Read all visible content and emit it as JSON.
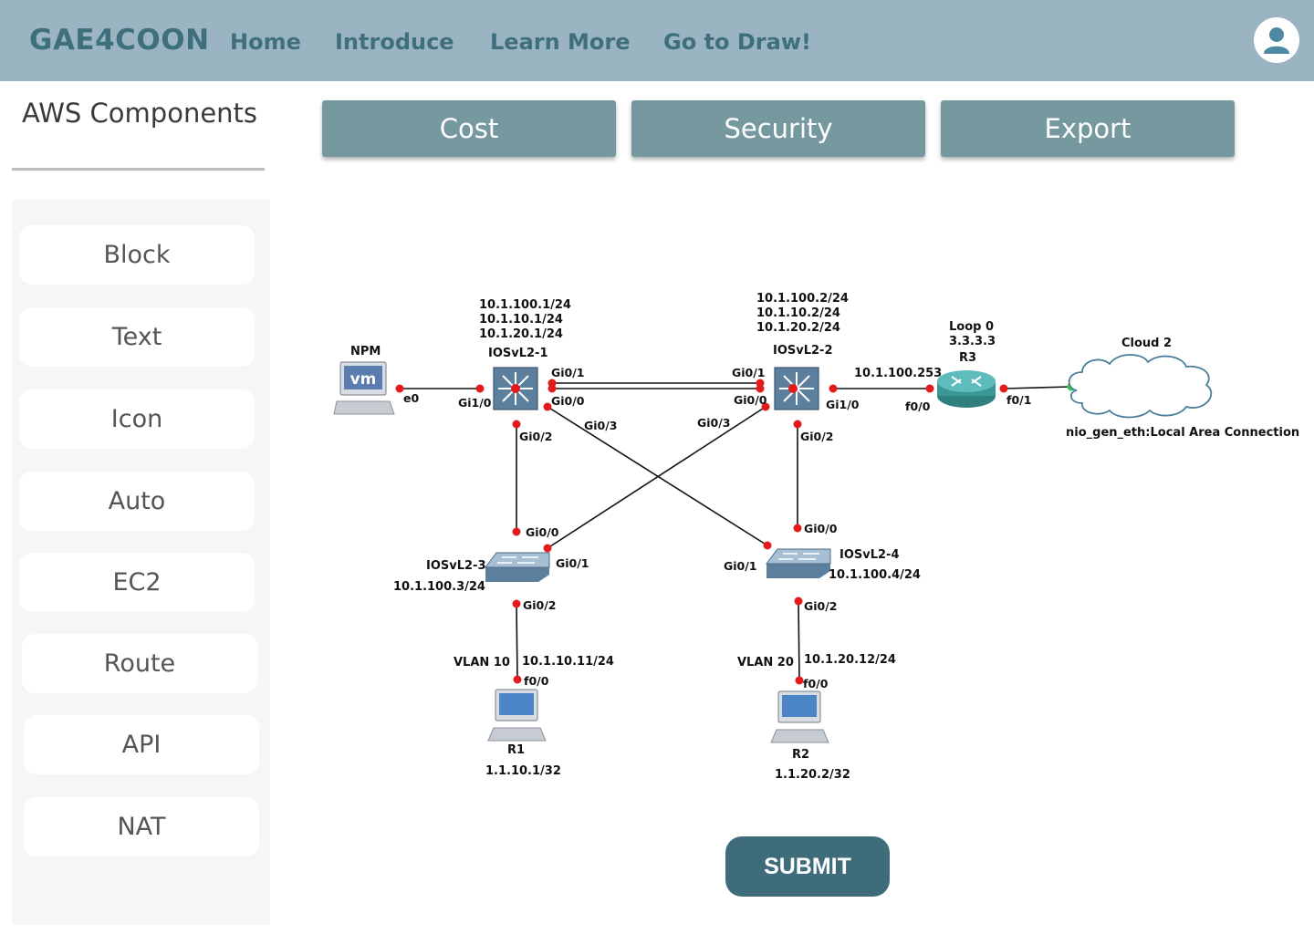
{
  "header": {
    "logo": "GAE4COON",
    "nav": [
      "Home",
      "Introduce",
      "Learn More",
      "Go to Draw!"
    ],
    "avatar_icon": "user-avatar-icon"
  },
  "sidebar": {
    "title": "AWS Components",
    "items": [
      "Block",
      "Text",
      "Icon",
      "Auto",
      "EC2",
      "Route",
      "API",
      "NAT"
    ]
  },
  "toolbar": {
    "cost": "Cost",
    "security": "Security",
    "export": "Export"
  },
  "diagram": {
    "npm": {
      "name": "NPM",
      "icon_text": "vm",
      "port": "e0"
    },
    "sw1": {
      "name": "IOSvL2-1",
      "ip1": "10.1.100.1/24",
      "ip2": "10.1.10.1/24",
      "ip3": "10.1.20.1/24",
      "p_gi10": "Gi1/0",
      "p_gi01": "Gi0/1",
      "p_gi00": "Gi0/0",
      "p_gi03": "Gi0/3",
      "p_gi02": "Gi0/2"
    },
    "sw2": {
      "name": "IOSvL2-2",
      "ip1": "10.1.100.2/24",
      "ip2": "10.1.10.2/24",
      "ip3": "10.1.20.2/24",
      "p_gi01": "Gi0/1",
      "p_gi00": "Gi0/0",
      "p_gi10": "Gi1/0",
      "p_gi03": "Gi0/3",
      "p_gi02": "Gi0/2",
      "link_ip": "10.1.100.253"
    },
    "r3": {
      "name": "R3",
      "loop": "Loop 0",
      "loop_ip": "3.3.3.3",
      "p_f00": "f0/0",
      "p_f01": "f0/1"
    },
    "cloud": {
      "name": "Cloud 2",
      "label": "nio_gen_eth:Local Area Connection"
    },
    "sw3": {
      "name": "IOSvL2-3",
      "ip": "10.1.100.3/24",
      "p_gi00": "Gi0/0",
      "p_gi01": "Gi0/1",
      "p_gi02": "Gi0/2"
    },
    "sw4": {
      "name": "IOSvL2-4",
      "ip": "10.1.100.4/24",
      "p_gi00": "Gi0/0",
      "p_gi01": "Gi0/1",
      "p_gi02": "Gi0/2"
    },
    "r1": {
      "name": "R1",
      "vlan": "VLAN 10",
      "ip": "10.1.10.11/24",
      "port": "f0/0",
      "loop_ip": "1.1.10.1/32"
    },
    "r2": {
      "name": "R2",
      "vlan": "VLAN 20",
      "ip": "10.1.20.12/24",
      "port": "f0/0",
      "loop_ip": "1.1.20.2/32"
    }
  },
  "submit": "SUBMIT"
}
